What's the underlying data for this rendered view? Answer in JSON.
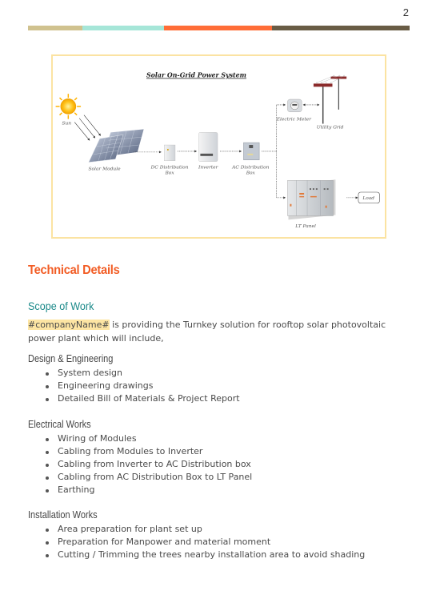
{
  "page": {
    "number": "2",
    "bar_colors": [
      "#d0c28f",
      "#a6e6d8",
      "#ff6d37",
      "#695c45"
    ]
  },
  "figure": {
    "title": "Solar On-Grid Power System",
    "labels": {
      "sun": "Sun",
      "solar_module": "Solar Module",
      "dc_box_line1": "DC Distribution",
      "dc_box_line2": "Box",
      "inverter": "Inverter",
      "ac_box_line1": "AC Distribution",
      "ac_box_line2": "Box",
      "electric_meter": "Electric Meter",
      "utility_grid": "Utility Grid",
      "lt_panel": "LT Panel",
      "load": "Load"
    },
    "border_color": "#fbe3a2"
  },
  "content": {
    "section_title": "Technical Details",
    "subsection_title": "Scope of Work",
    "intro_placeholder": "#companyName#",
    "intro_text": " is providing the Turnkey solution for rooftop solar photovoltaic power plant which will include,",
    "groups": [
      {
        "title": "Design & Engineering",
        "items": [
          "System design",
          "Engineering drawings",
          "Detailed Bill of Materials & Project Report"
        ]
      },
      {
        "title": "Electrical Works",
        "items": [
          "Wiring of Modules",
          "Cabling from Modules to Inverter",
          "Cabling from Inverter to AC Distribution box",
          "Cabling from AC Distribution Box to LT Panel",
          "Earthing"
        ]
      },
      {
        "title": "Installation Works",
        "items": [
          "Area preparation for plant set up",
          "Preparation for Manpower and material moment",
          "Cutting / Trimming the trees nearby installation area to avoid shading"
        ]
      }
    ],
    "colors": {
      "section_title": "#f25c24",
      "subsection_title": "#1c8a8a",
      "highlight": "#fde5a3"
    }
  }
}
